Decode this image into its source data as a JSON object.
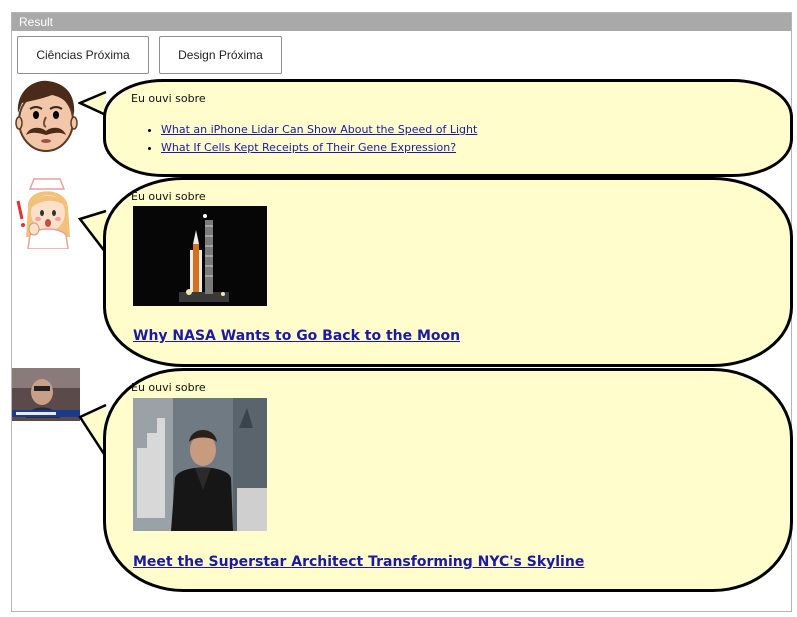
{
  "window": {
    "title": "Result"
  },
  "toolbar": {
    "button1": "Ciências Próxima",
    "button2": "Design Próxima"
  },
  "messages": [
    {
      "intro": "Eu ouvi sobre",
      "links": [
        "What an iPhone Lidar Can Show About the Speed of Light",
        "What If Cells Kept Receipts of Their Gene Expression?"
      ]
    },
    {
      "intro": "Eu ouvi sobre",
      "title": "Why NASA Wants to Go Back to the Moon"
    },
    {
      "intro": "Eu ouvi sobre",
      "title": "Meet the Superstar Architect Transforming NYC's Skyline"
    }
  ],
  "colors": {
    "bubble": "#fffdcc",
    "link": "#1a1aa6",
    "titlebar": "#a9a9a9"
  }
}
